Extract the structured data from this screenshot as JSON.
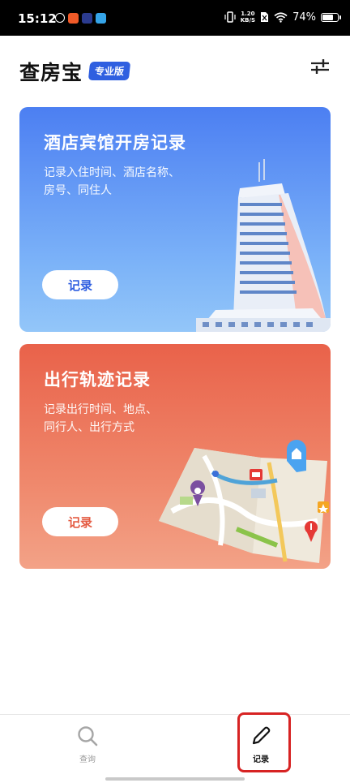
{
  "status_bar": {
    "time": "15:12",
    "network_speed_value": "1.20",
    "network_speed_unit": "KB/S",
    "battery_text": "74%",
    "battery_level": 0.74
  },
  "header": {
    "title": "查房宝",
    "badge": "专业版",
    "settings_icon": "sliders-icon"
  },
  "cards": {
    "hotel": {
      "title": "酒店宾馆开房记录",
      "desc_line1": "记录入住时间、酒店名称、",
      "desc_line2": "房号、同住人",
      "button": "记录"
    },
    "travel": {
      "title": "出行轨迹记录",
      "desc_line1": "记录出行时间、地点、",
      "desc_line2": "同行人、出行方式",
      "button": "记录"
    }
  },
  "bottom_nav": {
    "items": [
      {
        "label": "查询",
        "icon": "search-icon",
        "active": false
      },
      {
        "label": "记录",
        "icon": "pencil-icon",
        "active": true
      }
    ]
  },
  "colors": {
    "accent": "#2f5fe0",
    "hotel_card": "#5a8cf4",
    "travel_card": "#ec7356",
    "highlight": "#d72323"
  }
}
